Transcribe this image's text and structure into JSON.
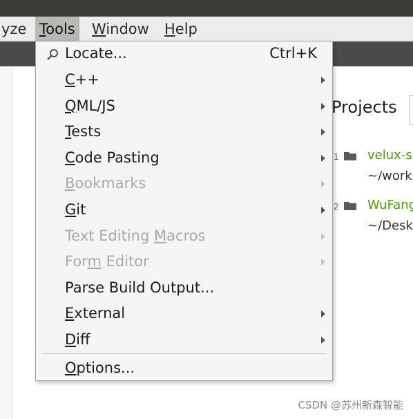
{
  "menubar": {
    "items": [
      {
        "pre": "",
        "accel": "",
        "post": "yze"
      },
      {
        "pre": "",
        "accel": "T",
        "post": "ools"
      },
      {
        "pre": "",
        "accel": "W",
        "post": "indow"
      },
      {
        "pre": "",
        "accel": "H",
        "post": "elp"
      }
    ]
  },
  "tools_menu": {
    "locate": {
      "label": "Locate...",
      "shortcut": "Ctrl+K",
      "icon": "search-icon"
    },
    "items": [
      {
        "pre": "",
        "accel": "C",
        "post": "++"
      },
      {
        "pre": "",
        "accel": "Q",
        "post": "ML/JS"
      },
      {
        "pre": "",
        "accel": "T",
        "post": "ests"
      },
      {
        "pre": "",
        "accel": "C",
        "post": "ode Pasting"
      },
      {
        "pre": "",
        "accel": "B",
        "post": "ookmarks"
      },
      {
        "pre": "",
        "accel": "G",
        "post": "it"
      },
      {
        "pre": "Text Editing ",
        "accel": "M",
        "post": "acros"
      },
      {
        "pre": "For",
        "accel": "m",
        "post": " Editor"
      },
      {
        "pre": "Parse Build Output...",
        "accel": "",
        "post": ""
      },
      {
        "pre": "",
        "accel": "E",
        "post": "xternal"
      },
      {
        "pre": "",
        "accel": "D",
        "post": "iff"
      },
      {
        "pre": "",
        "accel": "O",
        "post": "ptions..."
      }
    ]
  },
  "welcome": {
    "projects_title": "Projects",
    "recent": [
      {
        "num": "1",
        "name": "velux-sr",
        "path": "~/works",
        "icon": "folder-icon"
      },
      {
        "num": "2",
        "name": "WuFang",
        "path": "~/Deskt",
        "icon": "folder-icon"
      }
    ]
  },
  "watermark": "CSDN @苏州新森智能"
}
